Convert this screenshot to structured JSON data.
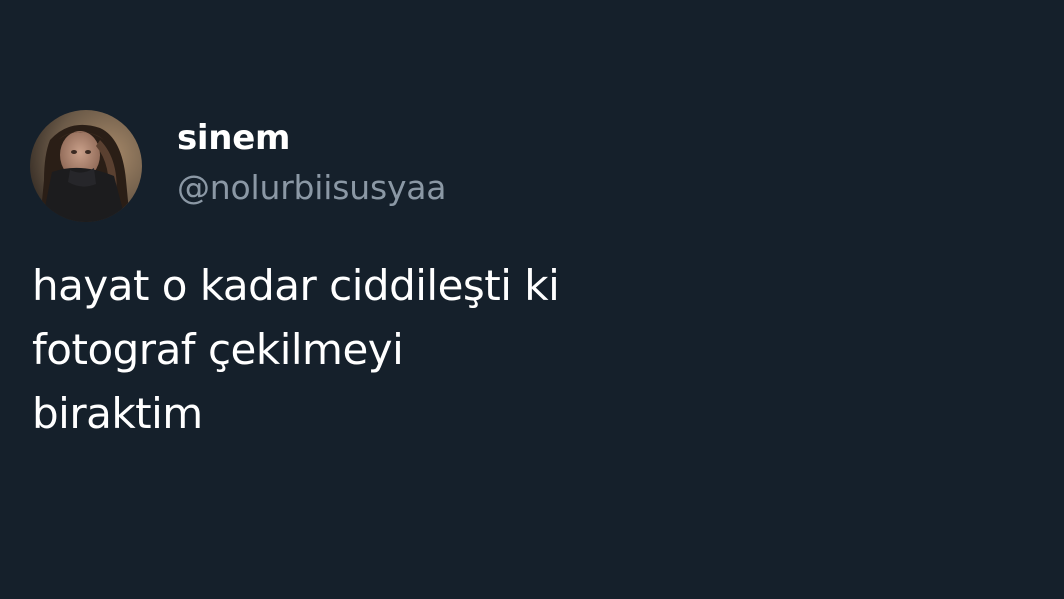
{
  "tweet": {
    "author": {
      "display_name": "sinem",
      "handle": "@nolurbiisusyaa",
      "avatar_icon": "profile-photo"
    },
    "text_lines": [
      "hayat o kadar ciddileşti ki",
      "fotograf çekilmeyi",
      "biraktim"
    ]
  },
  "colors": {
    "background": "#15202b",
    "primary_text": "#ffffff",
    "secondary_text": "#8b98a5"
  }
}
